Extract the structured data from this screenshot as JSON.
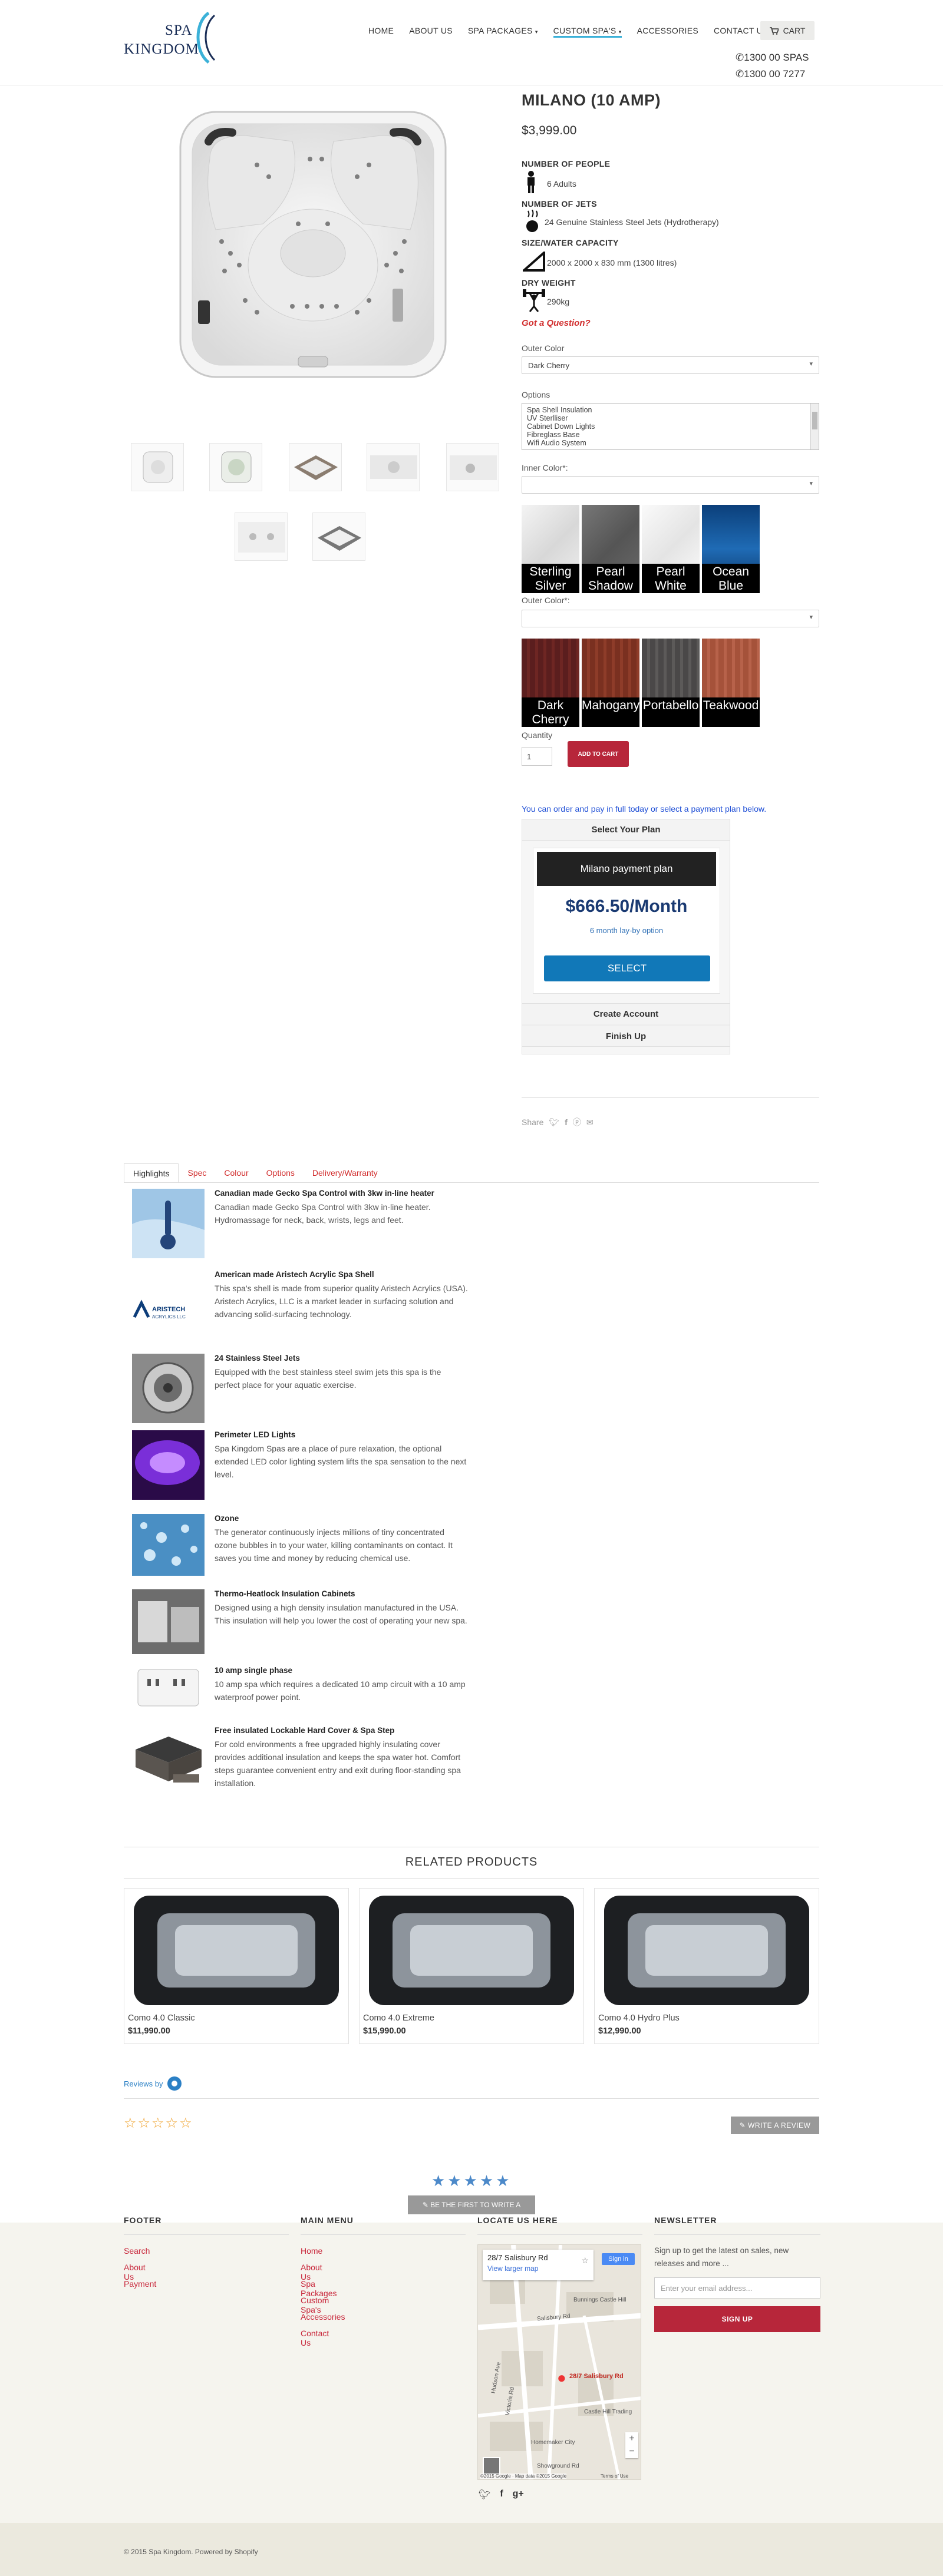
{
  "header": {
    "logo_line1": "SPA",
    "logo_line2": "KINGDOM",
    "nav": [
      "HOME",
      "ABOUT US",
      "SPA PACKAGES",
      "CUSTOM SPA'S",
      "ACCESSORIES",
      "CONTACT US"
    ],
    "cart_label": "CART",
    "phone1": "1300 00 SPAS",
    "phone2": "1300 00 7277"
  },
  "product": {
    "title": "MILANO (10 AMP)",
    "price": "$3,999.00",
    "specs": [
      {
        "heading": "NUMBER OF PEOPLE",
        "value": "6 Adults"
      },
      {
        "heading": "NUMBER OF JETS",
        "value": "24 Genuine Stainless Steel Jets (Hydrotherapy)"
      },
      {
        "heading": "SIZE/WATER CAPACITY",
        "value": "2000 x 2000 x 830 mm (1300 litres)"
      },
      {
        "heading": "DRY WEIGHT",
        "value": "290kg"
      }
    ],
    "question": "Got a Question?",
    "outer_color_label": "Outer Color",
    "outer_color_value": "Dark Cherry",
    "options_label": "Options",
    "options_list": [
      "Spa Shell Insulation",
      "UV Sterlliser",
      "Cabinet Down Lights",
      "Fibreglass Base",
      "Wifi Audio System"
    ],
    "inner_color_label": "Inner Color*:",
    "inner_swatches": [
      "Sterling Silver",
      "Pearl Shadow",
      "Pearl White",
      "Ocean Blue"
    ],
    "outer_color2_label": "Outer Color*:",
    "outer_swatches": [
      "Dark Cherry",
      "Mahogany",
      "Portabello",
      "Teakwood"
    ],
    "quantity_label": "Quantity",
    "quantity_value": "1",
    "add_to_cart": "ADD TO CART",
    "payment_note": "You can order and pay in full today or select a payment plan below.",
    "plan": {
      "select_header": "Select Your Plan",
      "plan_name": "Milano payment plan",
      "amount": "$666.50/Month",
      "subtitle": "6 month lay-by option",
      "select_button": "SELECT",
      "create_account": "Create Account",
      "finish_up": "Finish Up"
    },
    "share_label": "Share"
  },
  "tabs": [
    "Highlights",
    "Spec",
    "Colour",
    "Options",
    "Delivery/Warranty"
  ],
  "features": [
    {
      "title": "Canadian made Gecko Spa Control with 3kw in-line heater",
      "desc": "Canadian made Gecko Spa Control with 3kw in-line heater. Hydromassage for neck, back, wrists, legs and feet."
    },
    {
      "title": "American made Aristech Acrylic Spa Shell",
      "desc": "This spa's shell is made from superior quality Aristech Acrylics (USA). Aristech Acrylics, LLC is a market leader in surfacing solution and advancing solid-surfacing technology."
    },
    {
      "title": "24 Stainless Steel Jets",
      "desc": "Equipped with the best stainless steel swim jets this spa is the perfect place for your aquatic exercise."
    },
    {
      "title": "Perimeter LED Lights",
      "desc": "Spa Kingdom Spas are a place of pure relaxation, the optional extended LED color lighting system lifts the spa sensation to the next level."
    },
    {
      "title": "Ozone",
      "desc": "The generator continuously injects millions of tiny concentrated ozone bubbles in to your water, killing contaminants on contact. It saves you time and money by reducing chemical use."
    },
    {
      "title": "Thermo-Heatlock Insulation Cabinets",
      "desc": "Designed using a high density insulation manufactured in the USA. This insulation will help you lower the cost of operating your new spa."
    },
    {
      "title": "10 amp single phase",
      "desc": "10 amp spa which requires a dedicated 10 amp circuit with a 10 amp waterproof power point."
    },
    {
      "title": "Free insulated Lockable Hard Cover & Spa Step",
      "desc": "For cold environments a free upgraded highly insulating cover provides additional insulation and keeps the spa water hot. Comfort steps guarantee convenient entry and exit during floor-standing spa installation."
    }
  ],
  "aristech_logo": "ARISTECH ACRYLICS",
  "related": {
    "title": "RELATED PRODUCTS",
    "items": [
      {
        "name": "Como 4.0 Classic",
        "price": "$11,990.00"
      },
      {
        "name": "Como 4.0 Extreme",
        "price": "$15,990.00"
      },
      {
        "name": "Como 4.0 Hydro Plus",
        "price": "$12,990.00"
      }
    ]
  },
  "reviews": {
    "reviews_by": "Reviews by",
    "write_review": "WRITE A REVIEW",
    "be_first": "BE THE FIRST TO WRITE A REVIEW",
    "stars_empty": "☆☆☆☆☆",
    "stars_filled": "★★★★★"
  },
  "footer": {
    "col1_title": "FOOTER",
    "col1_links": [
      "Search",
      "About Us",
      "Payment"
    ],
    "col2_title": "MAIN MENU",
    "col2_links": [
      "Home",
      "About Us",
      "Spa Packages",
      "Custom Spa's",
      "Accessories",
      "Contact Us"
    ],
    "col3_title": "LOCATE US HERE",
    "col4_title": "NEWSLETTER",
    "map_address": "28/7 Salisbury Rd",
    "map_link": "View larger map",
    "map_pin_label": "28/7 Salisbury Rd",
    "map_signin": "Sign in",
    "map_streets": [
      "Salisbury Rd",
      "Bunnings Castle Hill",
      "Castle Hill Trading",
      "Victoria Rd",
      "Homemaker City",
      "Showground Rd",
      "Hudson Ave"
    ],
    "map_credit": "©2015 Google · Map data ©2015 Google",
    "map_terms": "Terms of Use",
    "newsletter_text": "Sign up to get the latest on sales, new releases and more ...",
    "email_placeholder": "Enter your email address...",
    "signup": "SIGN UP",
    "copyright": "© 2015 Spa Kingdom. Powered by Shopify"
  },
  "colors": {
    "accent_red": "#b7263a",
    "link_red": "#c8273b",
    "nav_active": "#3bb1d8",
    "plan_blue": "#1178b8"
  }
}
